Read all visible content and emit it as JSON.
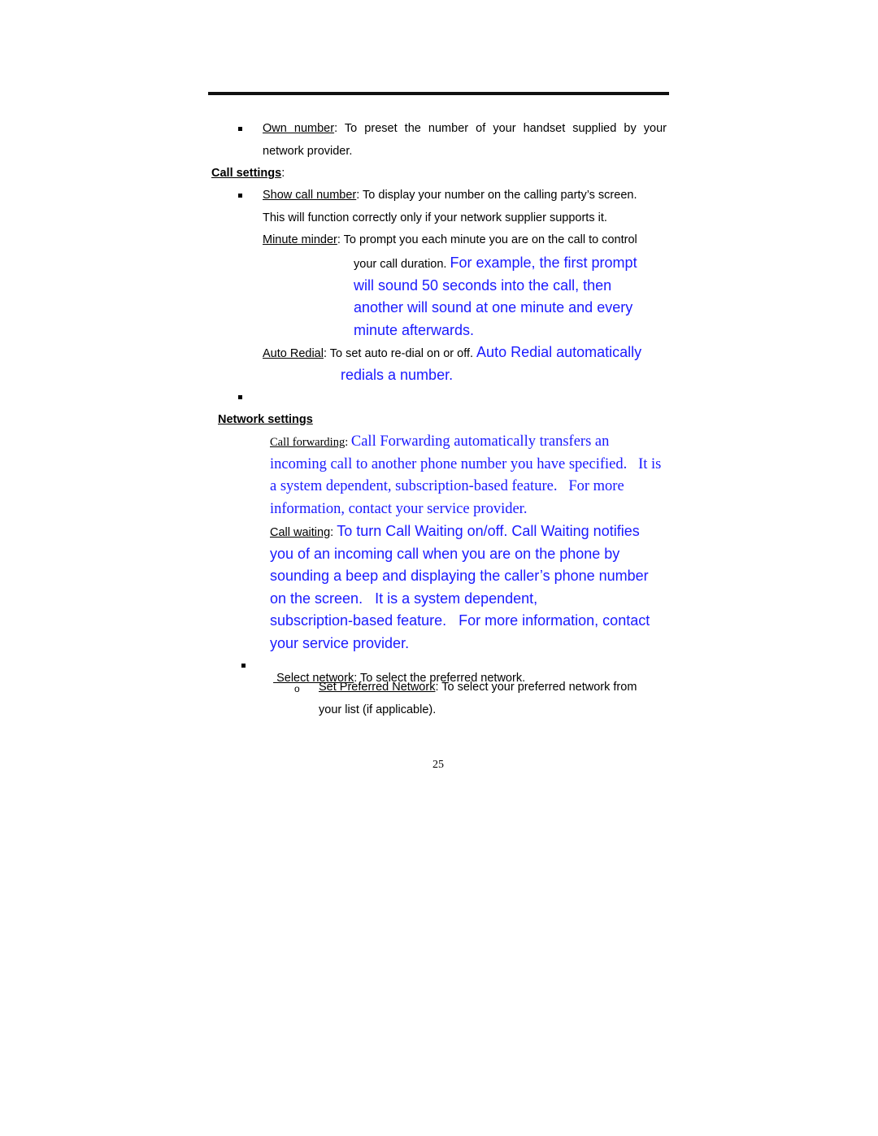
{
  "own_number": {
    "label": "Own number",
    "text_line1": ": To preset the number of your handset supplied by your",
    "text_line2": "network provider."
  },
  "call_settings": {
    "heading": "Call settings",
    "heading_suffix": ":",
    "show_call_number": {
      "label": "Show call number",
      "text_line1": ": To display your number on the calling party’s screen.",
      "text_line2": "This will function correctly only if your network supplier supports it."
    },
    "minute_minder": {
      "label": "Minute minder",
      "text_line1": ": To prompt you each minute you are on the call to control",
      "text_line2_black": "your call duration. ",
      "text_line2_blue": "For example, the first prompt",
      "blue_line3": "will sound 50 seconds into the call, then",
      "blue_line4": "another will sound at one minute and every",
      "blue_line5": "minute afterwards."
    },
    "auto_redial": {
      "label": "Auto Redial",
      "text_black": ": To set auto re-dial on or off. ",
      "text_blue_line1": "Auto Redial automatically",
      "text_blue_line2": "redials a number."
    }
  },
  "network_settings": {
    "heading": "Network settings",
    "call_forwarding": {
      "label": "Call forwarding",
      "colon": ": ",
      "line1": "Call Forwarding automatically transfers an",
      "line2": "incoming call to another phone number you have specified.   It is",
      "line3": "a system dependent, subscription-based feature.   For more",
      "line4": "information, contact your service provider."
    },
    "call_waiting": {
      "label": "Call waiting",
      "colon": ": ",
      "line1": "To turn Call Waiting on/off. Call Waiting notifies",
      "line2": "you of an incoming call when you are on the phone by",
      "line3": "sounding a beep and displaying the caller’s phone number",
      "line4": "on the screen.   It is a system dependent,",
      "line5": "subscription-based feature.   For more information, contact",
      "line6": "your service provider."
    },
    "select_network": {
      "label": " Select network",
      "text": ": To select the preferred network."
    },
    "set_preferred_network": {
      "label": "Set Preferred Network",
      "text_line1": ": To select your preferred network from",
      "text_line2": "your list (if applicable)."
    }
  },
  "colors": {
    "highlight_text": "#1a1aff",
    "body_text": "#000000"
  },
  "page_number": "25"
}
